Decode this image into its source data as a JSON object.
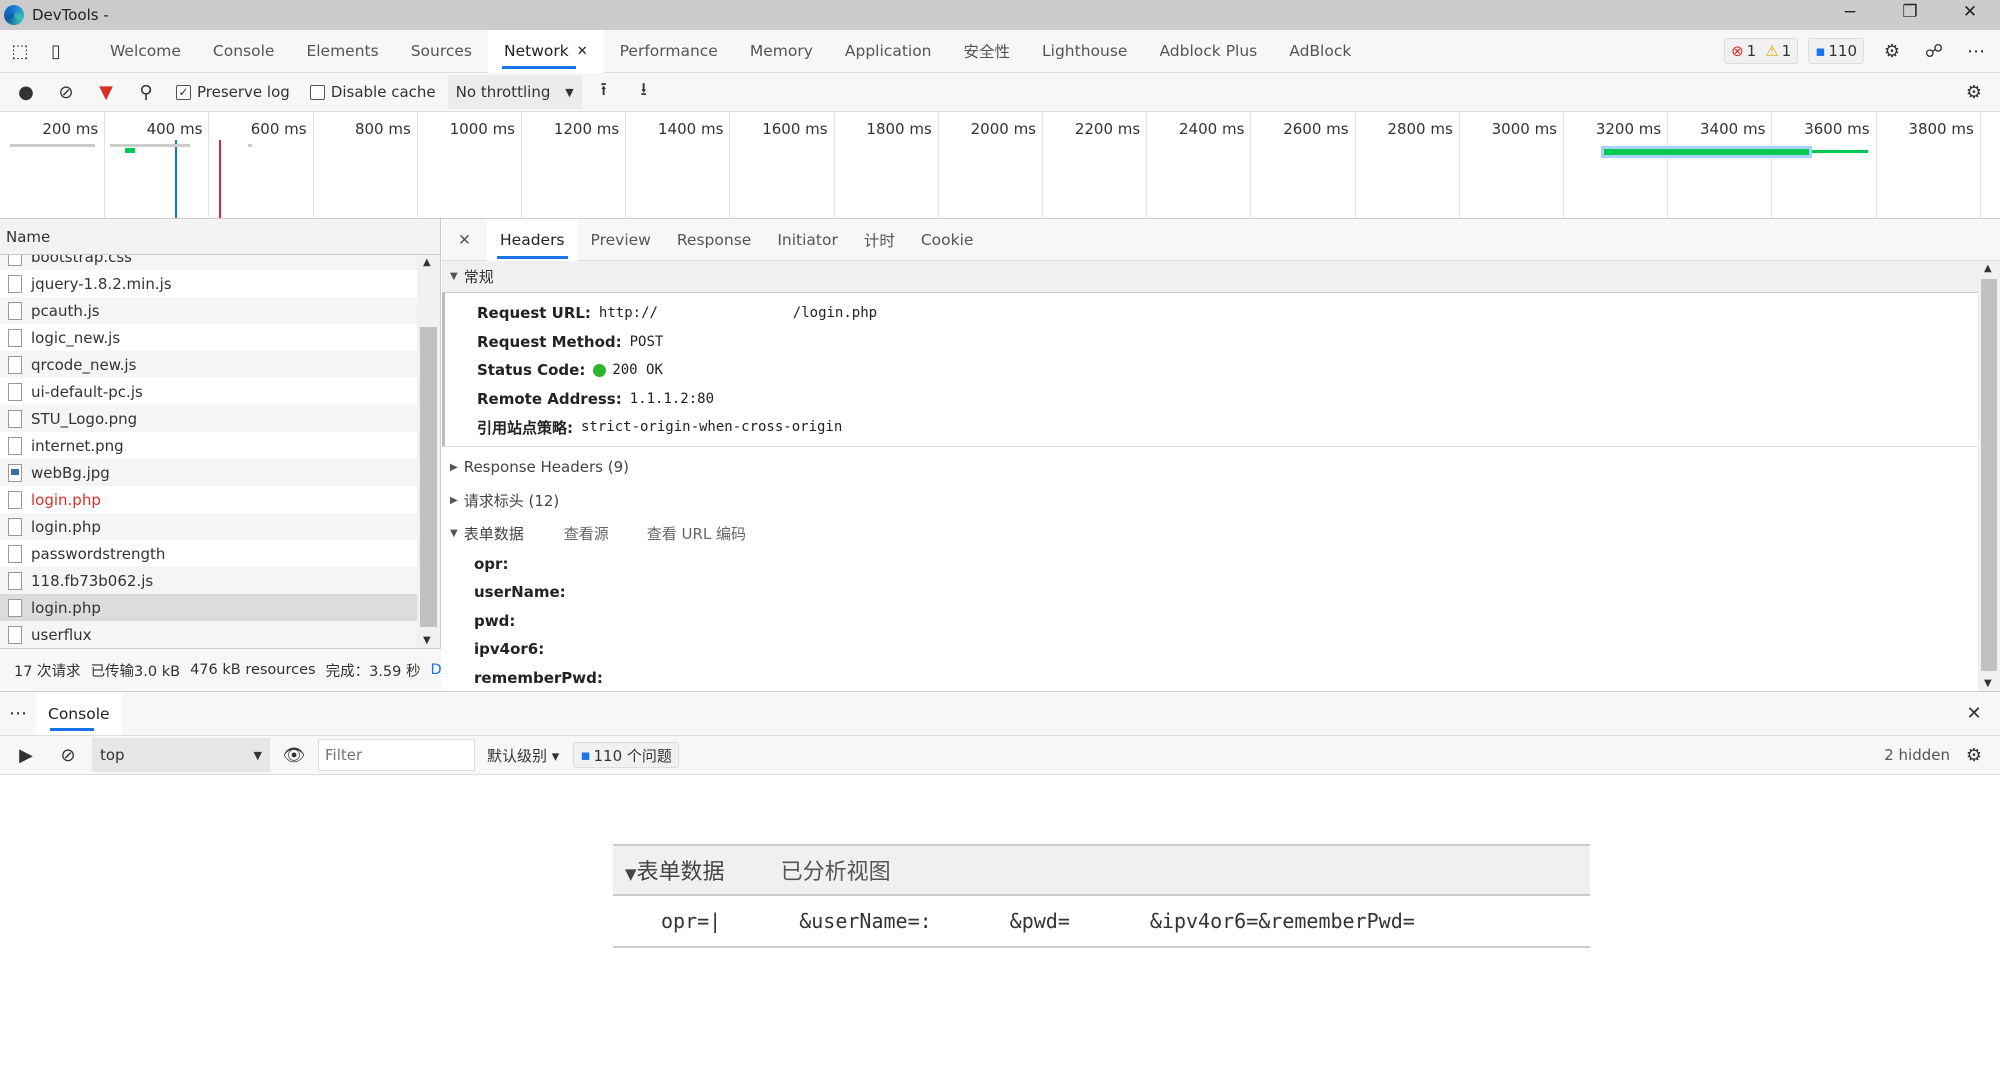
{
  "window": {
    "title": "DevTools -",
    "minimize": "−",
    "restore": "❐",
    "close": "✕"
  },
  "tabs": [
    {
      "label": "Welcome"
    },
    {
      "label": "Console"
    },
    {
      "label": "Elements"
    },
    {
      "label": "Sources"
    },
    {
      "label": "Network",
      "active": true
    },
    {
      "label": "Performance"
    },
    {
      "label": "Memory"
    },
    {
      "label": "Application"
    },
    {
      "label": "安全性"
    },
    {
      "label": "Lighthouse"
    },
    {
      "label": "Adblock Plus"
    },
    {
      "label": "AdBlock"
    }
  ],
  "badges": {
    "errors": "1",
    "warnings": "1",
    "issues": "110"
  },
  "toolbar": {
    "preserve_log": "Preserve log",
    "preserve_log_checked": true,
    "disable_cache": "Disable cache",
    "disable_cache_checked": false,
    "throttling": "No throttling"
  },
  "timeline": {
    "ticks": [
      "200 ms",
      "400 ms",
      "600 ms",
      "800 ms",
      "1000 ms",
      "1200 ms",
      "1400 ms",
      "1600 ms",
      "1800 ms",
      "2000 ms",
      "2200 ms",
      "2400 ms",
      "2600 ms",
      "2800 ms",
      "3000 ms",
      "3200 ms",
      "3400 ms",
      "3600 ms",
      "3800 ms"
    ],
    "dom_content_loaded_ms": 336,
    "load_ms": 420,
    "colors": {
      "dcl": "#1a73e8",
      "load": "#d32f2f",
      "bar": "#00c853"
    }
  },
  "requests": {
    "header": "Name",
    "items": [
      {
        "name": "bootstrap.css"
      },
      {
        "name": "jquery-1.8.2.min.js"
      },
      {
        "name": "pcauth.js"
      },
      {
        "name": "logic_new.js"
      },
      {
        "name": "qrcode_new.js"
      },
      {
        "name": "ui-default-pc.js"
      },
      {
        "name": "STU_Logo.png"
      },
      {
        "name": "internet.png"
      },
      {
        "name": "webBg.jpg",
        "type": "image"
      },
      {
        "name": "login.php",
        "error": true
      },
      {
        "name": "login.php"
      },
      {
        "name": "passwordstrength"
      },
      {
        "name": "118.fb73b062.js"
      },
      {
        "name": "login.php",
        "selected": true
      },
      {
        "name": "userflux"
      }
    ],
    "summary": {
      "requests": "17 次请求",
      "transferred": "已传输3.0 kB",
      "resources": "476 kB resources",
      "finish": "完成：3.59 秒",
      "dcl": "DC"
    }
  },
  "details": {
    "tabs": [
      "Headers",
      "Preview",
      "Response",
      "Initiator",
      "计时",
      "Cookie"
    ],
    "general": {
      "title": "常规",
      "fields": [
        {
          "k": "Request URL:",
          "v": "http://                /login.php"
        },
        {
          "k": "Request Method:",
          "v": "POST"
        },
        {
          "k": "Status Code:",
          "v": "200 OK"
        },
        {
          "k": "Remote Address:",
          "v": "1.1.1.2:80"
        },
        {
          "k": "引用站点策略:",
          "v": "strict-origin-when-cross-origin"
        }
      ]
    },
    "response_headers": "Response Headers (9)",
    "request_headers": "请求标头 (12)",
    "form": {
      "title": "表单数据",
      "view_source": "查看源",
      "view_url": "查看 URL 编码",
      "fields": [
        "opr:",
        "userName:",
        "pwd:",
        "ipv4or6:",
        "rememberPwd:"
      ]
    }
  },
  "console": {
    "tab": "Console",
    "context": "top",
    "filter_placeholder": "Filter",
    "level": "默认级别",
    "issues": "110 个问题",
    "hidden": "2 hidden"
  },
  "zoomed": {
    "title": "表单数据",
    "view": "已分析视图",
    "parts": [
      "opr=|",
      "&userName=:",
      "&pwd=",
      "&ipv4or6=&rememberPwd="
    ]
  }
}
